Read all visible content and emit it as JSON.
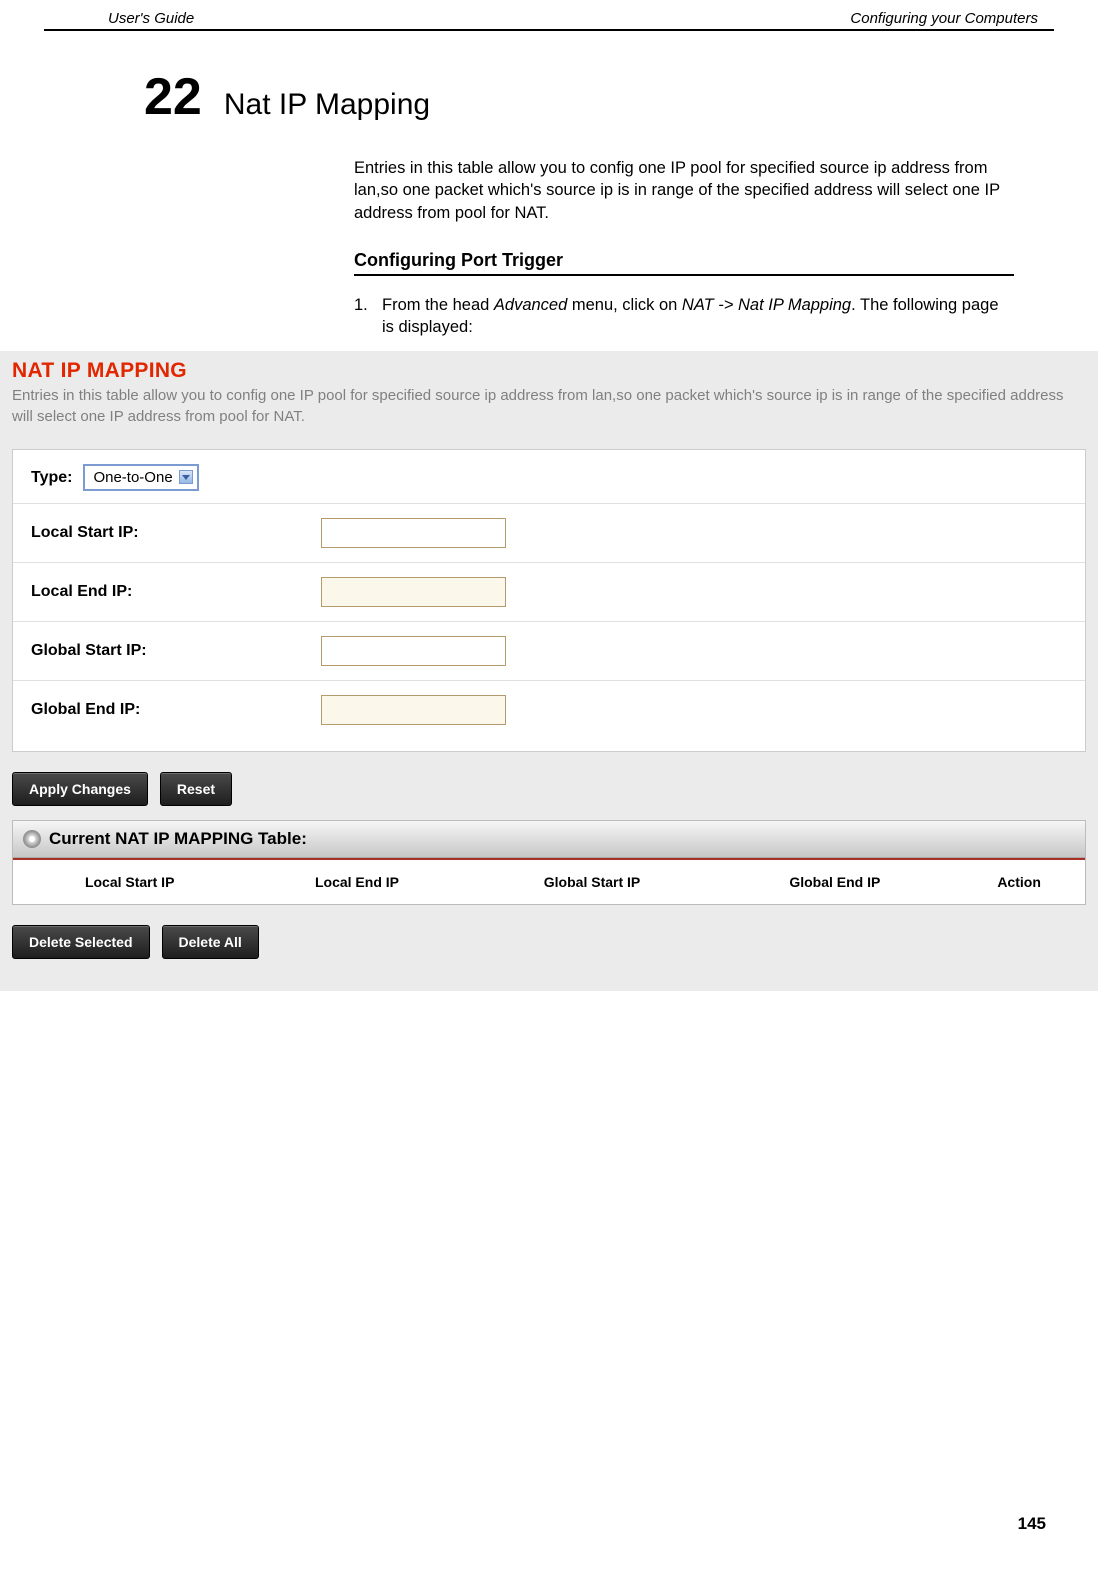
{
  "header": {
    "left": "User's Guide",
    "right": "Configuring your Computers"
  },
  "chapter": {
    "number": "22",
    "title": "Nat IP Mapping"
  },
  "intro": "Entries in this table allow you to config one IP pool for specified source ip address from lan,so one packet which's source ip is in range of the specified address will select one IP address from pool for NAT.",
  "section_heading": "Configuring Port Trigger",
  "step": {
    "num": "1.",
    "lead": "From the head ",
    "menu1": "Advanced",
    "mid": " menu, click on ",
    "menu2": "NAT -> Nat IP Mapping",
    "tail": ". The following page is displayed:"
  },
  "screenshot": {
    "title": "NAT IP MAPPING",
    "desc": "Entries in this table allow you to config one IP pool for specified source ip address from lan,so one packet which's source ip is in range of the specified address will select one IP address from pool for NAT.",
    "type_label": "Type:",
    "type_value": "One-to-One",
    "rows": [
      {
        "label": "Local Start IP:",
        "alt": false
      },
      {
        "label": "Local End IP:",
        "alt": true
      },
      {
        "label": "Global Start IP:",
        "alt": false
      },
      {
        "label": "Global End IP:",
        "alt": true
      }
    ],
    "apply_btn": "Apply Changes",
    "reset_btn": "Reset",
    "table_caption": "Current NAT IP MAPPING Table:",
    "columns": [
      "Local Start IP",
      "Local End IP",
      "Global Start IP",
      "Global End IP",
      "Action"
    ],
    "delete_selected_btn": "Delete Selected",
    "delete_all_btn": "Delete All"
  },
  "page_number": "145"
}
